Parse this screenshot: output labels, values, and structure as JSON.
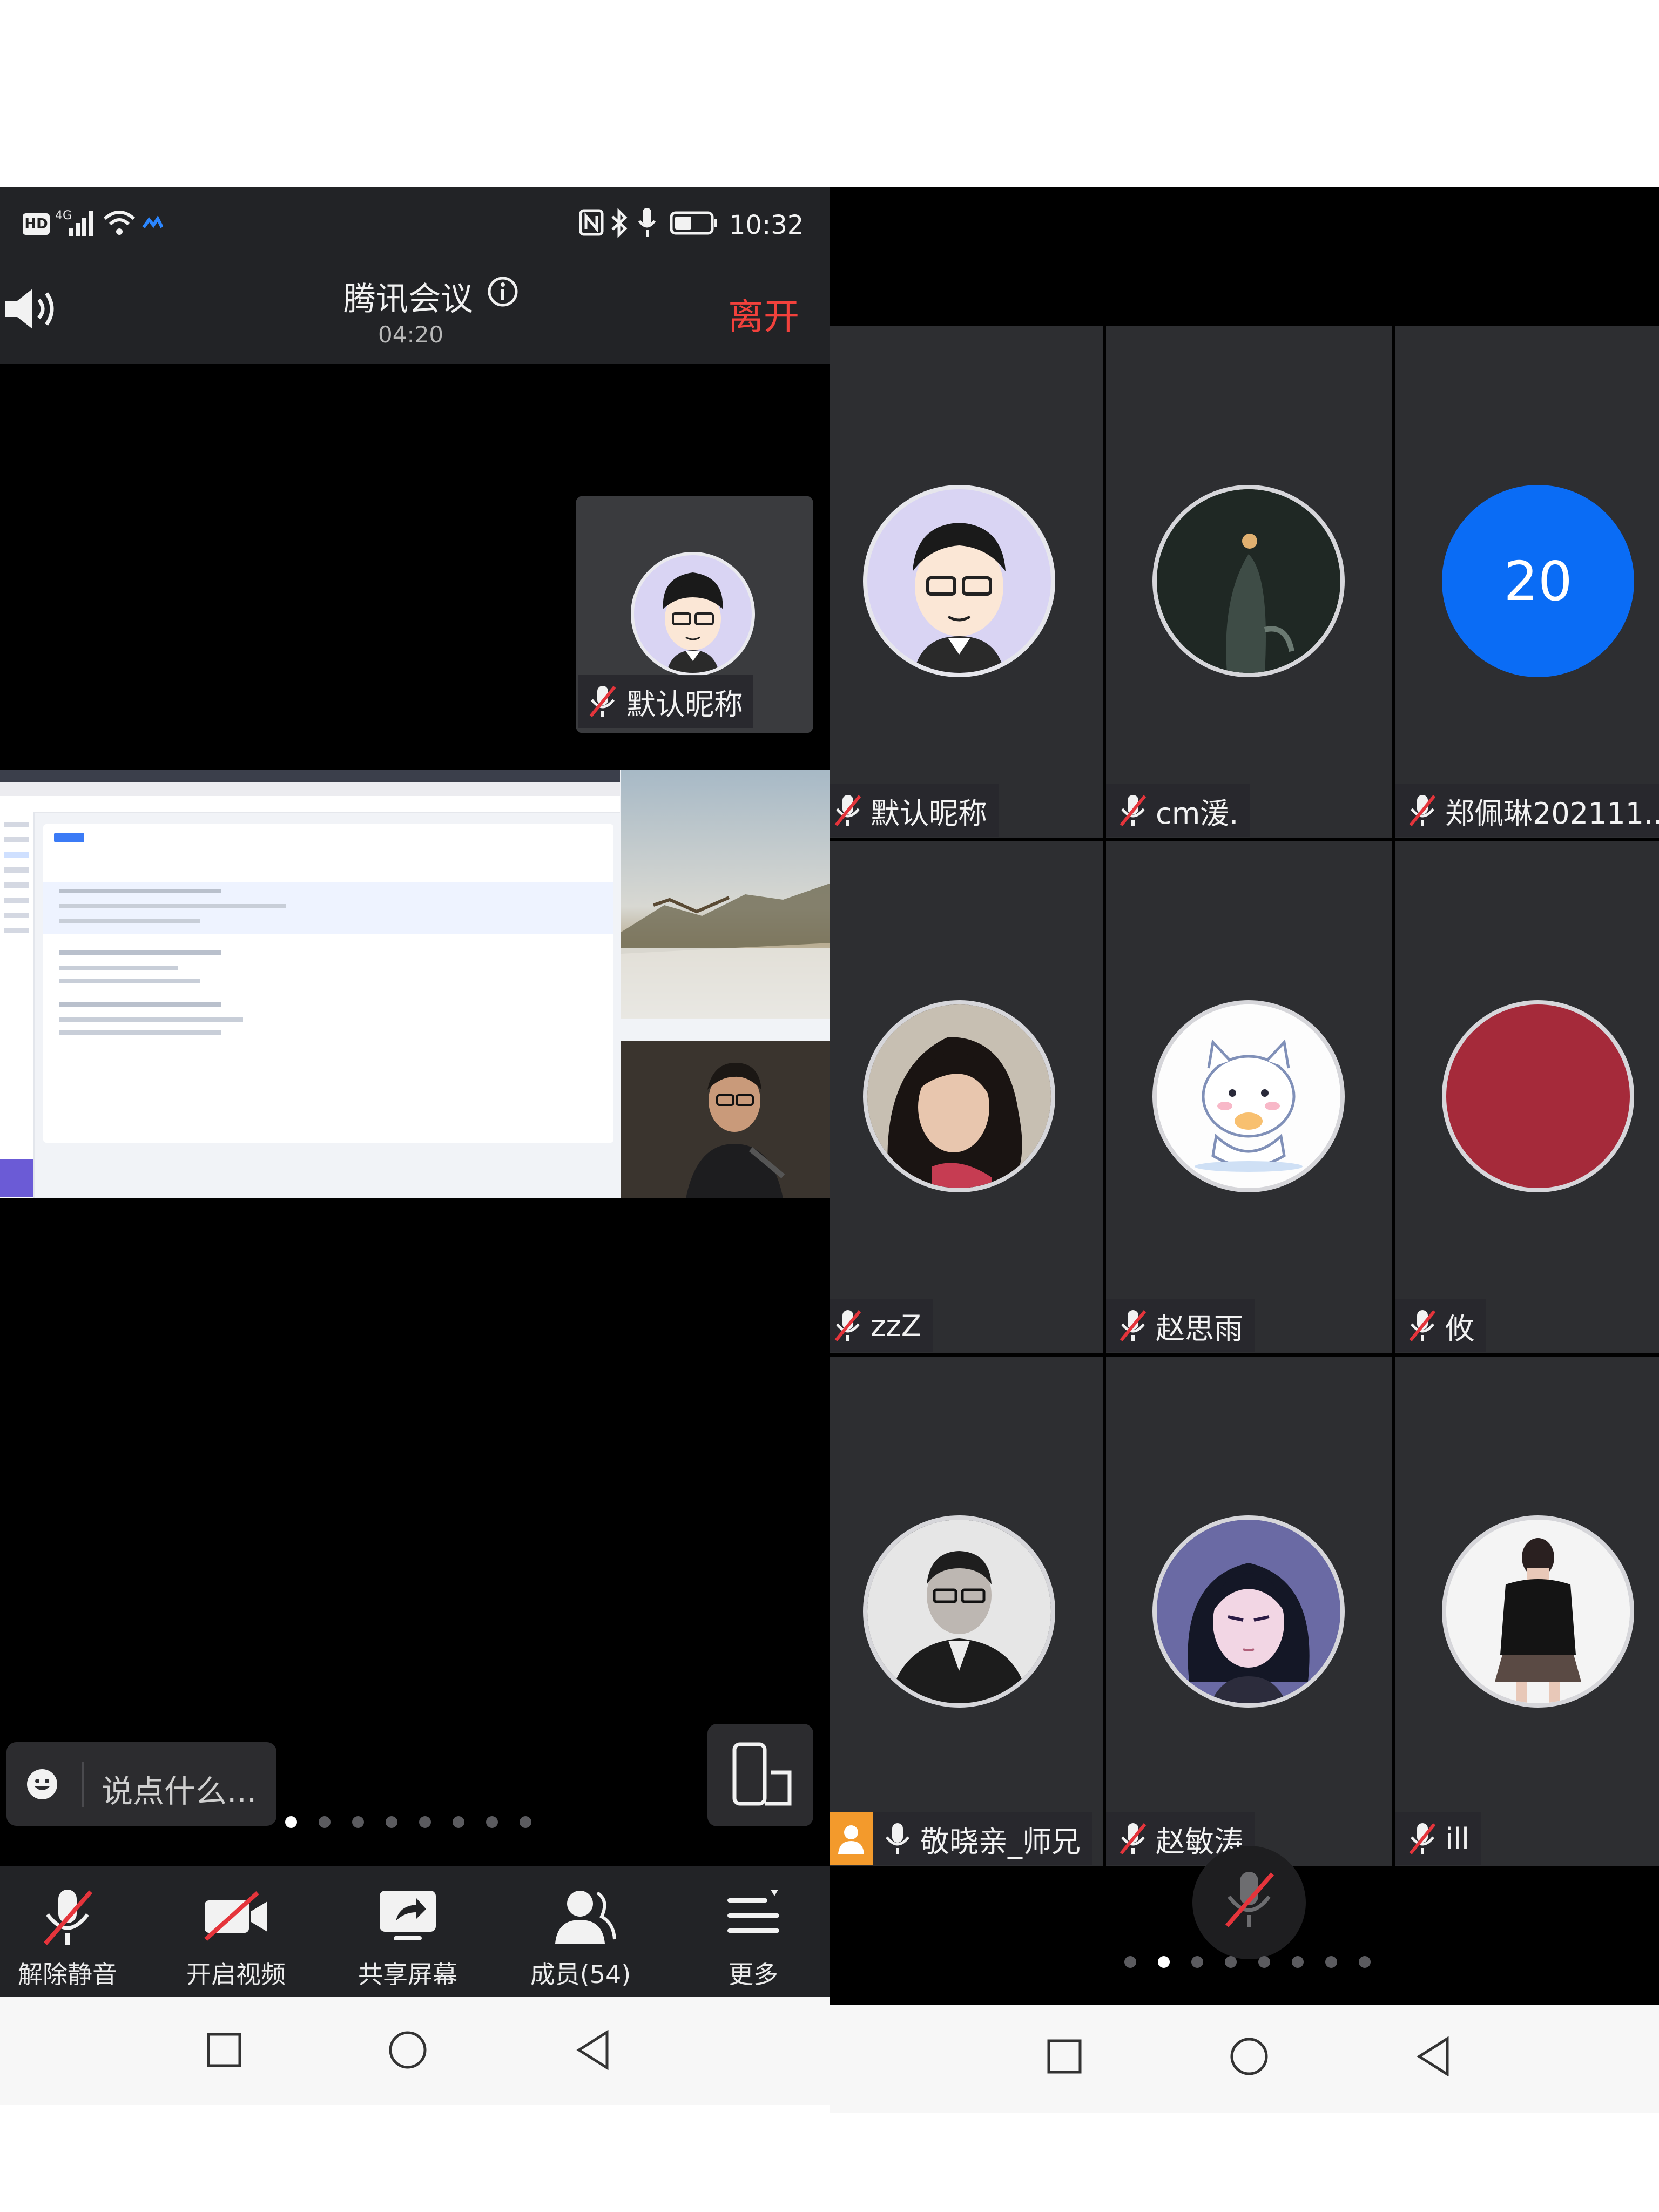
{
  "status_bar": {
    "hd": "HD",
    "network": "4G",
    "time": "10:32"
  },
  "meeting": {
    "title": "腾讯会议",
    "elapsed": "04:20",
    "leave_label": "离开"
  },
  "self_view": {
    "name": "默认昵称"
  },
  "chat": {
    "placeholder": "说点什么..."
  },
  "left_page_dots": {
    "count": 8,
    "active": 0
  },
  "toolbar": {
    "unmute_label": "解除静音",
    "video_label": "开启视频",
    "share_label": "共享屏幕",
    "members_label": "成员(54)",
    "more_label": "更多"
  },
  "participants": [
    {
      "name": "默认昵称",
      "avatar": "cartoon-boy-glasses",
      "muted": true
    },
    {
      "name": "cm湲.",
      "avatar": "dark-photo",
      "muted": true
    },
    {
      "name": "郑佩琳202111...",
      "avatar_text": "20",
      "avatar_color": "#0a6cf5",
      "muted": true
    },
    {
      "name": "zzZ",
      "avatar": "woman-curly-hair-photo",
      "muted": true
    },
    {
      "name": "赵思雨",
      "avatar": "cartoon-cat",
      "muted": true
    },
    {
      "name": "攸",
      "avatar_color": "#a52a3a",
      "muted": true
    },
    {
      "name": "敬晓亲_师兄",
      "avatar": "man-suit-photo",
      "muted": false,
      "badge": "person-icon"
    },
    {
      "name": "赵敏涛",
      "avatar": "anime-girl",
      "muted": true
    },
    {
      "name": "ill",
      "avatar": "girl-photo",
      "muted": true
    }
  ],
  "right_page_dots": {
    "count": 8,
    "active": 1
  },
  "colors": {
    "accent_blue": "#0a6cf5",
    "leave_red": "#f2413c",
    "mute_red": "#e5343b",
    "badge_orange": "#f39a2c"
  }
}
